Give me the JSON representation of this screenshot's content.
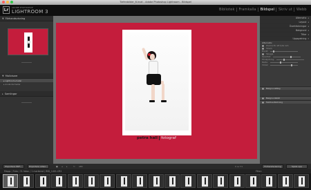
{
  "window": {
    "title": "Tiefenbilder_6.lrcat - Adobe Photoshop Lightroom - Bildspel",
    "traffic_lights": [
      "#fc605c",
      "#fdbc40",
      "#34c84a"
    ]
  },
  "app": {
    "logo_text": "Lr",
    "subtitle": "ADOBE PHOTOSHOP",
    "name": "LIGHTROOM 3"
  },
  "modules": [
    "Bibliotek",
    "Framkalla",
    "Bildspel",
    "Skriv ut",
    "Webb"
  ],
  "active_module": "Bildspel",
  "left_panel": {
    "preview_header": "Förhandsvisning",
    "templates_header": "Mallvisare",
    "templates": [
      "Lightroom-mallar",
      "Användarmallar"
    ],
    "collections_header": "Samlingar"
  },
  "right_panel": {
    "sections": [
      "Alternativ",
      "Layout",
      "Övertäckningar",
      "Bakgrund",
      "Titlar",
      "Uppspelning"
    ],
    "options_title": "Alternativ",
    "zoom_label": "Zooma för att fylla ram",
    "stroke_label": "Streck",
    "width_label": "Bredd:",
    "shadow_label": "Skugga",
    "opacity_label": "Opacitet:",
    "offset_label": "Förskjutning:",
    "radius_label": "Radie:",
    "angle_label": "Vinkel:",
    "bg_label": "Bakgrundsfärg",
    "bg_image_label": "Bakgrundsbild",
    "text_label": "Textövertäckning",
    "preview_button": "Förhandsvisning",
    "play_button": "Spela upp"
  },
  "canvas": {
    "background_color": "#c41d3c",
    "identity_plate": "petra hall",
    "identity_suffix": "fotograf"
  },
  "bottom": {
    "export_pdf": "Exportera PDF...",
    "export_video": "Exportera video...",
    "toolbar_text": "ABC",
    "slide_count": "9 av 31",
    "filter_text": "Mapp: / Foto / 31 foton / 1 markerat / IMG_1401.CR2",
    "filter_right": "Filter:"
  },
  "filmstrip": {
    "thumb_count": 19,
    "selected_index": 0
  }
}
